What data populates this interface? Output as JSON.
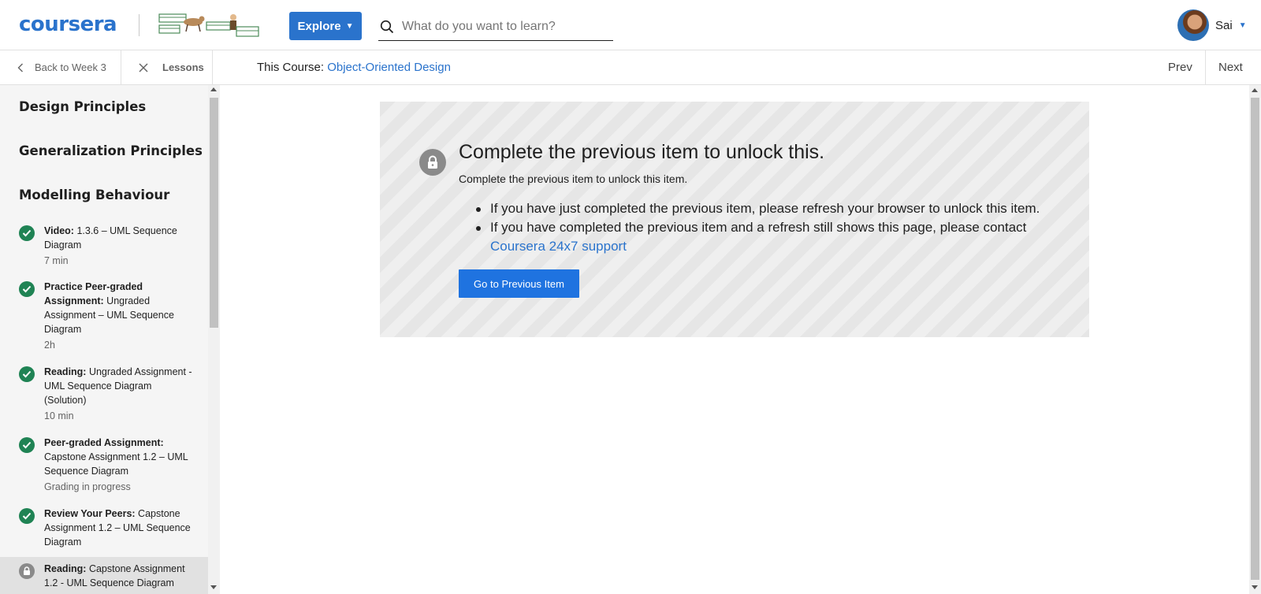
{
  "header": {
    "logo_text": "coursera",
    "explore_label": "Explore",
    "search_placeholder": "What do you want to learn?",
    "user_name": "Sai"
  },
  "subnav": {
    "back_label": "Back to Week 3",
    "lessons_label": "Lessons",
    "course_prefix": "This Course:",
    "course_name": "Object-Oriented Design",
    "prev_label": "Prev",
    "next_label": "Next"
  },
  "sidebar": {
    "sections": [
      {
        "title": "Design Principles"
      },
      {
        "title": "Generalization Principles"
      },
      {
        "title": "Modelling Behaviour"
      }
    ],
    "items": [
      {
        "type_label": "Video:",
        "title": " 1.3.6 – UML Sequence Diagram",
        "meta": "7 min",
        "status": "completed"
      },
      {
        "type_label": "Practice Peer-graded Assignment:",
        "title": " Ungraded Assignment – UML Sequence Diagram",
        "meta": "2h",
        "status": "completed"
      },
      {
        "type_label": "Reading:",
        "title": " Ungraded Assignment - UML Sequence Diagram (Solution)",
        "meta": "10 min",
        "status": "completed"
      },
      {
        "type_label": "Peer-graded Assignment:",
        "title": " Capstone Assignment 1.2 – UML Sequence Diagram",
        "meta": "Grading in progress",
        "status": "completed"
      },
      {
        "type_label": "Review Your Peers:",
        "title": " Capstone Assignment 1.2 – UML Sequence Diagram",
        "meta": "",
        "status": "completed"
      },
      {
        "type_label": "Reading:",
        "title": " Capstone Assignment 1.2 - UML Sequence Diagram",
        "meta": "",
        "status": "locked"
      }
    ]
  },
  "lock_card": {
    "title": "Complete the previous item to unlock this.",
    "subtitle": "Complete the previous item to unlock this item.",
    "bullet_1": "If you have just completed the previous item, please refresh your browser to unlock this item.",
    "bullet_2_text": "If you have completed the previous item and a refresh still shows this page, please contact",
    "bullet_2_link": "Coursera 24x7 support",
    "button_label": "Go to Previous Item"
  },
  "colors": {
    "brand": "#2a73cc",
    "completed": "#1f8354",
    "locked": "#8a8a8a",
    "button": "#1f73e0"
  }
}
